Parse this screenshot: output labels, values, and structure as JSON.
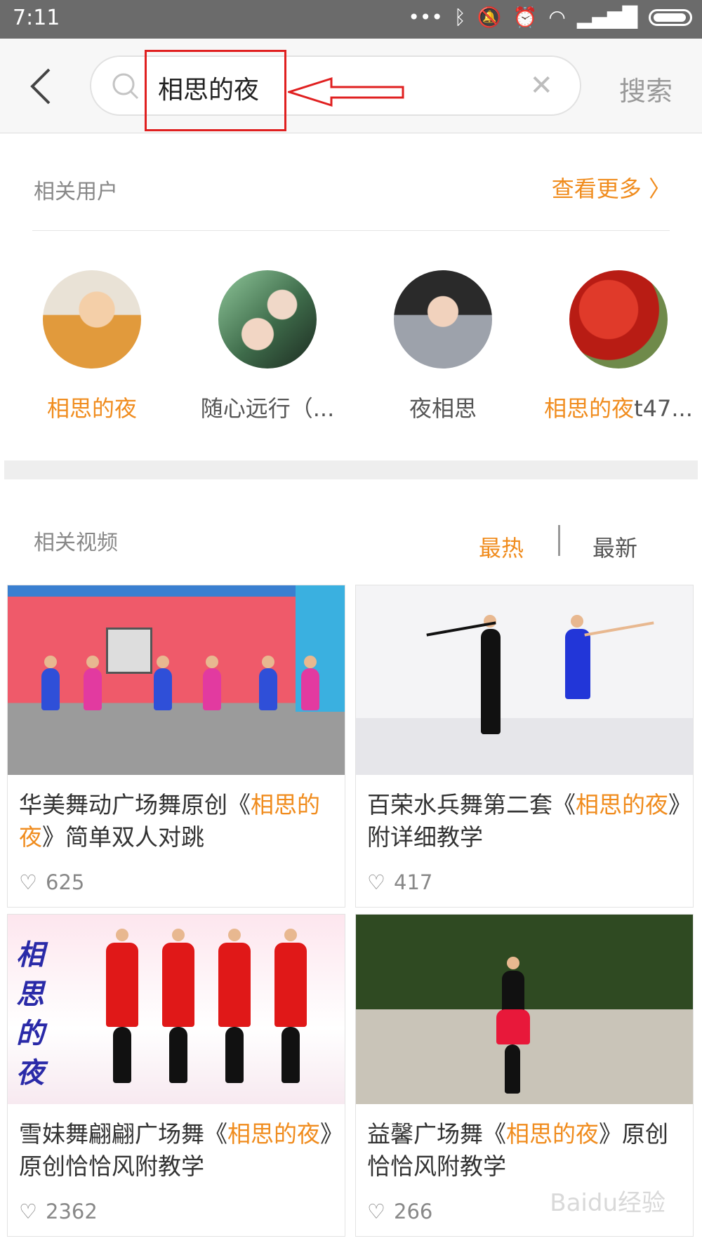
{
  "status_bar": {
    "time": "7:11"
  },
  "header": {
    "search_query": "相思的夜",
    "search_button": "搜索"
  },
  "related_users": {
    "title": "相关用户",
    "more_label": "查看更多",
    "users": [
      {
        "name_highlight": "相思的夜",
        "name_rest": ""
      },
      {
        "name_highlight": "",
        "name_rest": "随心远行（..."
      },
      {
        "name_highlight": "",
        "name_rest": "夜相思"
      },
      {
        "name_highlight": "相思的夜",
        "name_rest": "t47..."
      }
    ]
  },
  "related_videos": {
    "title": "相关视频",
    "tabs": {
      "hot": "最热",
      "new": "最新"
    },
    "videos": [
      {
        "pre": "华美舞动广场舞原创《",
        "hl": "相思的夜",
        "post": "》简单双人对跳",
        "likes": "625"
      },
      {
        "pre": "百荣水兵舞第二套《",
        "hl": "相思的夜",
        "post": "》附详细教学",
        "likes": "417"
      },
      {
        "pre": "雪妹舞翩翩广场舞《",
        "hl": "相思的夜",
        "post": "》原创恰恰风附教学",
        "likes": "2362"
      },
      {
        "pre": "益馨广场舞《",
        "hl": "相思的夜",
        "post": "》原创恰恰风附教学",
        "likes": "266"
      }
    ],
    "thumb3_overlay": "相思的夜"
  },
  "watermark": "Baidu经验"
}
